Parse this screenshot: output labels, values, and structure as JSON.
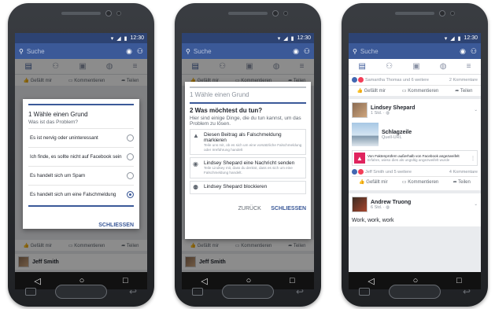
{
  "status": {
    "time": "12:30"
  },
  "search": {
    "placeholder": "Suche"
  },
  "feed_actions": {
    "like": "Gefällt mir",
    "comment": "Kommentieren",
    "share": "Teilen"
  },
  "phone1": {
    "step_title": "1  Wähle einen Grund",
    "step_question": "Was ist das Problem?",
    "options": [
      "Es ist nervig oder uninteressant",
      "Ich finde, es sollte nicht auf Facebook sein",
      "Es handelt sich um Spam",
      "Es handelt sich um eine Falschmeldung"
    ],
    "selected_index": 3,
    "close_label": "SCHLIESSEN",
    "bottom_name": "Jeff Smith"
  },
  "phone2": {
    "step1_title": "1  Wähle einen Grund",
    "step2_title": "2  Was möchtest du tun?",
    "step2_desc": "Hier sind einige Dinge, die du tun kannst, um das Problem zu lösen.",
    "options": [
      {
        "title": "Diesen Beitrag als Falschmeldung markieren",
        "desc": "Teile uns mit, ob es sich um eine vorsätzliche Falschmeldung oder Irreführung handelt",
        "icon": "warning-icon"
      },
      {
        "title": "Lindsey Shepard eine Nachricht senden",
        "desc": "Teile Lindsey mit, dass du denkst, dass es sich um eine Falschmeldung handelt.",
        "icon": "messenger-icon"
      },
      {
        "title": "Lindsey Shepard blockieren",
        "desc": "",
        "icon": "block-user-icon"
      }
    ],
    "back_label": "ZURÜCK",
    "close_label": "SCHLIESSEN",
    "bottom_name": "Jeff Smith"
  },
  "phone3": {
    "top_reactions": "Samantha Thomas und 6 weitere",
    "top_comments": "2 Kommentare",
    "post1": {
      "author": "Lindsey Shepard",
      "time": "1 Std.",
      "link_title": "Schlagzeile",
      "link_source": "Quell-URL",
      "warning_title": "Von Faktenprüfern außerhalb von Facebook angezweifelt",
      "warning_sub": "Erfahre, wieso dies als ungültig angezweifelt wurde",
      "reactions": "Jeff Smith und 5 weitere",
      "comments": "4 Kommentare"
    },
    "post2": {
      "author": "Andrew Truong",
      "time": "6 Std.",
      "text": "Work, work, work"
    }
  }
}
